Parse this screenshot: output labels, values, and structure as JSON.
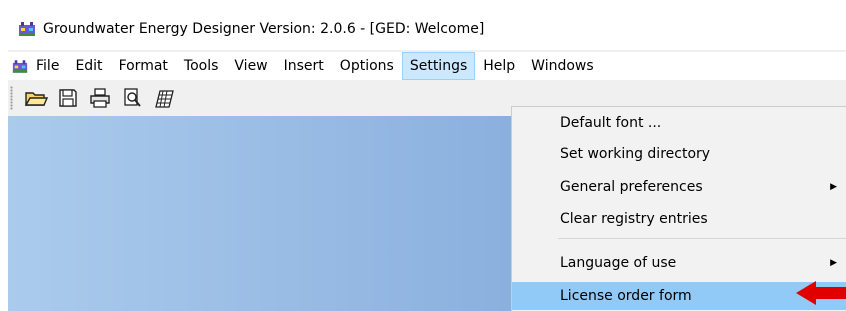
{
  "window": {
    "title": "Groundwater Energy Designer Version: 2.0.6 - [GED: Welcome]"
  },
  "menubar": {
    "items": [
      "File",
      "Edit",
      "Format",
      "Tools",
      "View",
      "Insert",
      "Options",
      "Settings",
      "Help",
      "Windows"
    ],
    "active": "Settings"
  },
  "toolbar": {
    "buttons": [
      "open-folder-icon",
      "save-icon",
      "print-icon",
      "print-preview-icon",
      "table-icon"
    ]
  },
  "settings_menu": {
    "items": [
      {
        "label": "Default font ...",
        "has_submenu": false
      },
      {
        "label": "Set working directory",
        "has_submenu": false
      },
      {
        "label": "General preferences",
        "has_submenu": true
      },
      {
        "label": "Clear registry entries",
        "has_submenu": false
      },
      {
        "label": "Language of use",
        "has_submenu": true
      },
      {
        "label": "License order form",
        "has_submenu": false,
        "highlighted": true
      }
    ],
    "submenu_arrow": "▶"
  },
  "colors": {
    "menu_highlight": "#91c9f7",
    "annotation_arrow": "#e00000"
  }
}
